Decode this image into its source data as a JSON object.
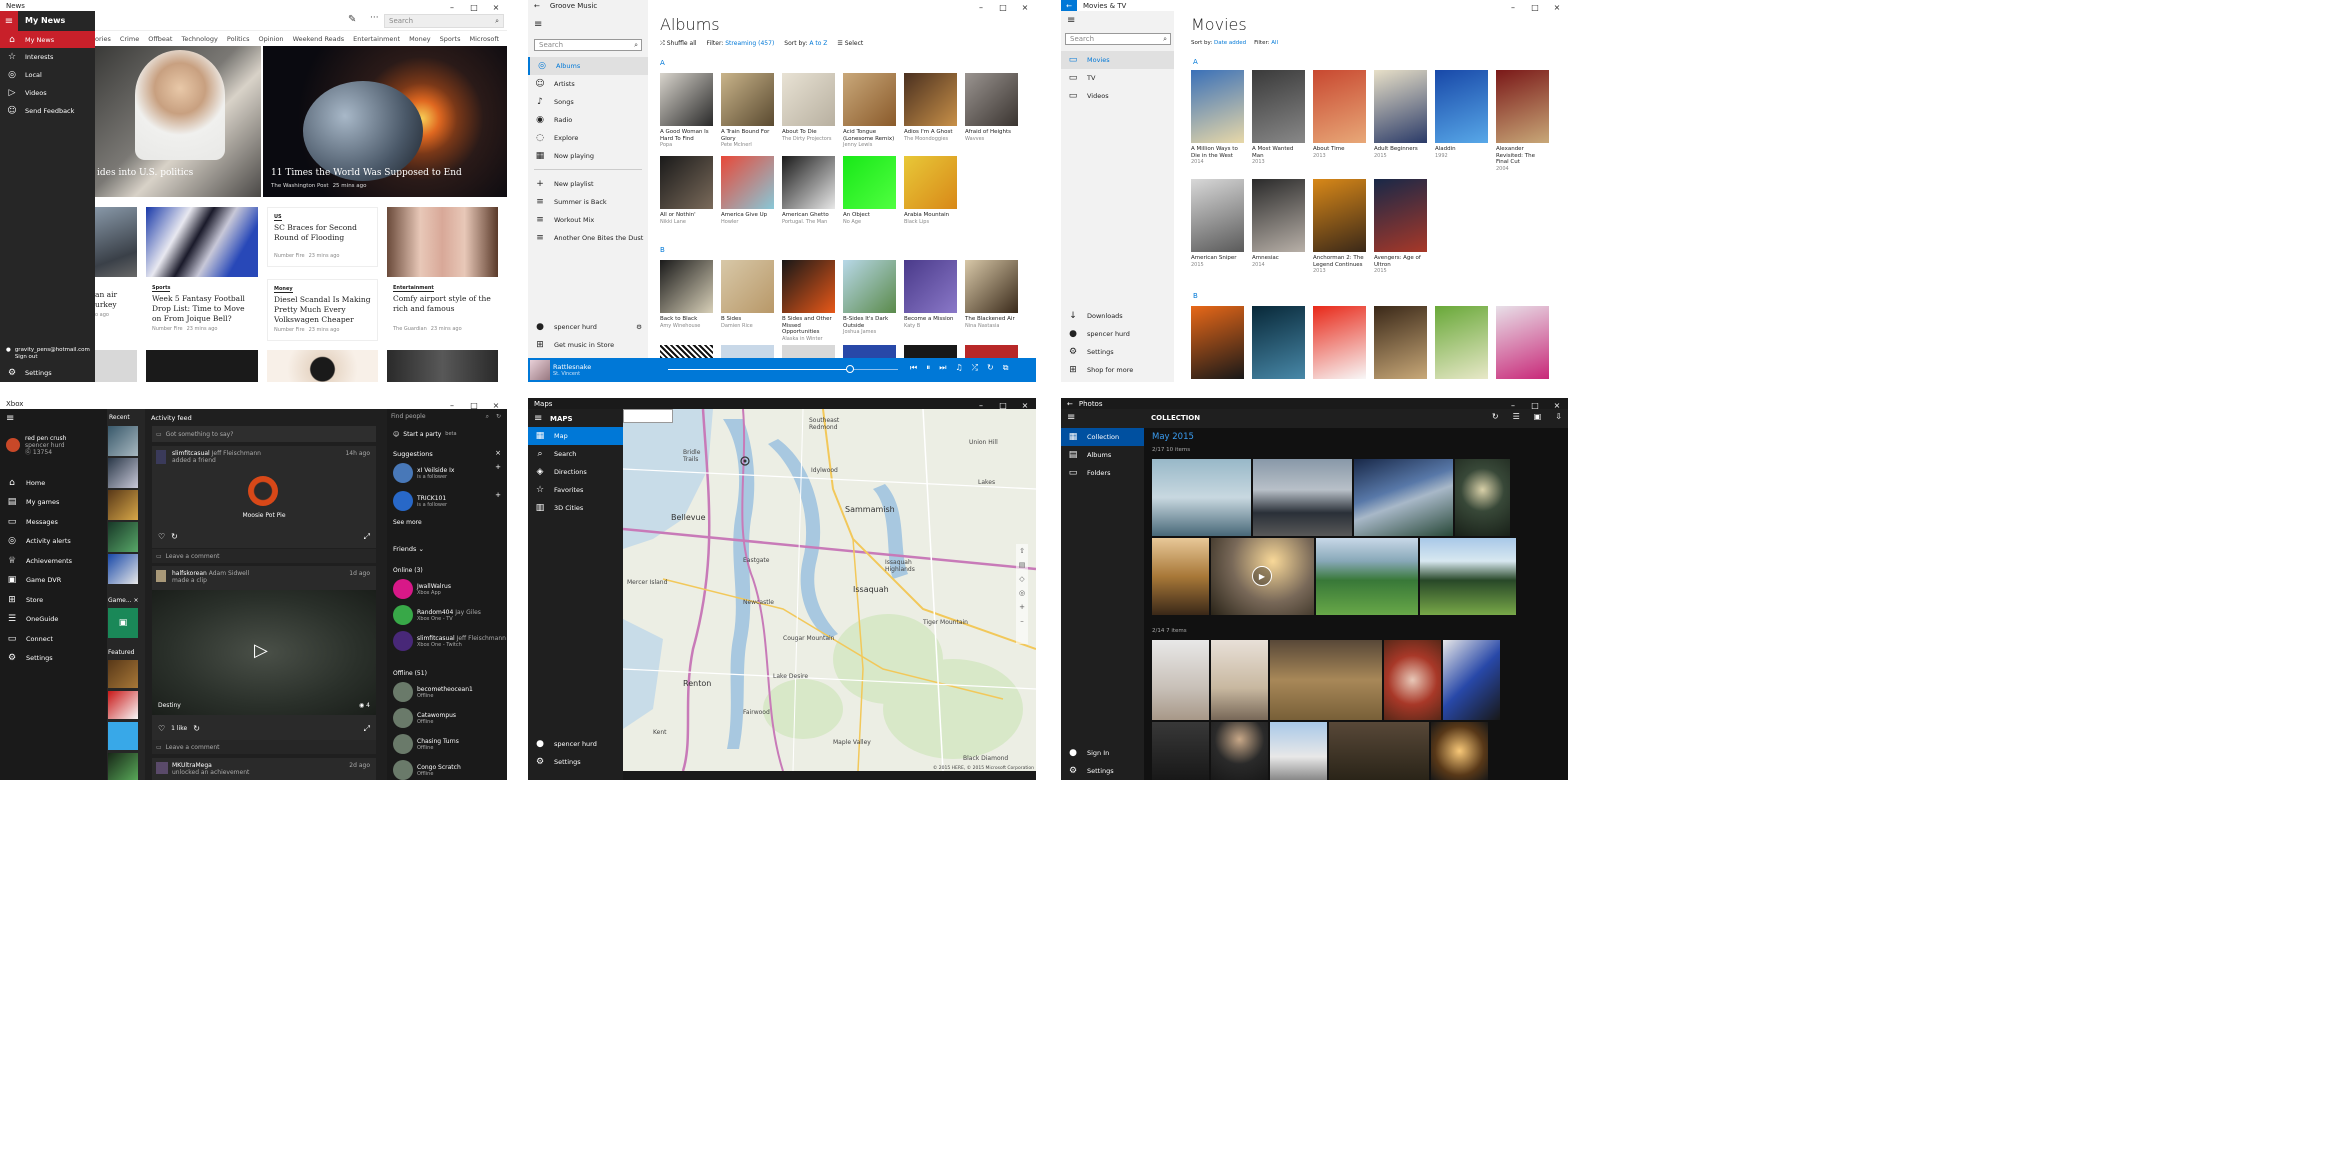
{
  "news": {
    "title": "News",
    "brand": "My News",
    "search_placeholder": "Search",
    "categories": [
      "ories",
      "Crime",
      "Offbeat",
      "Technology",
      "Politics",
      "Opinion",
      "Weekend Reads",
      "Entertainment",
      "Money",
      "Sports",
      "Microsoft"
    ],
    "nav": [
      {
        "label": "My News",
        "icon": "home-icon"
      },
      {
        "label": "Interests",
        "icon": "star-icon"
      },
      {
        "label": "Local",
        "icon": "pin-icon"
      },
      {
        "label": "Videos",
        "icon": "play-icon"
      },
      {
        "label": "Send Feedback",
        "icon": "feedback-icon"
      }
    ],
    "account": {
      "email": "gravity_pens@hotmail.com",
      "signout": "Sign out",
      "settings": "Settings"
    },
    "hero1": {
      "headline": "ides into U.S. politics"
    },
    "hero2": {
      "headline": "11 Times the World Was Supposed to End",
      "source": "The Washington Post",
      "time": "25 mins ago"
    },
    "cards": [
      {
        "tag": "",
        "headline": "an air\nurkey",
        "source": "",
        "time": "o ago"
      },
      {
        "tag": "Sports",
        "headline": "Week 5 Fantasy Football Drop List: Time to Move on From Joique Bell?",
        "source": "Number Fire",
        "time": "23 mins ago"
      },
      {
        "tag": "US",
        "headline": "SC Braces for Second Round of Flooding",
        "source": "Number Fire",
        "time": "23 mins ago"
      },
      {
        "tag": "Money",
        "headline": "Diesel Scandal Is Making Pretty Much Every Volkswagen Cheaper",
        "source": "Number Fire",
        "time": "23 mins ago"
      },
      {
        "tag": "Entertainment",
        "headline": "Comfy airport style of the rich and famous",
        "source": "The Guardian",
        "time": "23 mins ago"
      }
    ]
  },
  "groove": {
    "title": "Groove Music",
    "heading": "Albums",
    "search_placeholder": "Search",
    "toolbar": {
      "shuffle": "Shuffle all",
      "filter_label": "Filter:",
      "filter_value": "Streaming (457)",
      "sort_label": "Sort by:",
      "sort_value": "A to Z",
      "select": "Select"
    },
    "nav": [
      {
        "label": "Albums",
        "icon": "album-icon"
      },
      {
        "label": "Artists",
        "icon": "artist-icon"
      },
      {
        "label": "Songs",
        "icon": "note-icon"
      },
      {
        "label": "Radio",
        "icon": "radio-icon"
      },
      {
        "label": "Explore",
        "icon": "explore-icon"
      },
      {
        "label": "Now playing",
        "icon": "nowplaying-icon"
      }
    ],
    "playlists": [
      "New playlist",
      "Summer is Back",
      "Workout Mix",
      "Another One Bites the Dust"
    ],
    "user": "spencer hurd",
    "store": "Get music in Store",
    "now_playing": {
      "track": "Rattlesnake",
      "artist": "St. Vincent"
    },
    "section_a": "A",
    "section_b": "B",
    "albums_a1": [
      {
        "t": "A Good Woman Is Hard To Find",
        "a": "Popa",
        "c1": "#d8d4cc",
        "c2": "#2a2a2a"
      },
      {
        "t": "A Train Bound For Glory",
        "a": "Pete McInerl",
        "c1": "#c9b48a",
        "c2": "#5a4a30"
      },
      {
        "t": "About To Die",
        "a": "The Dirty Projectors",
        "c1": "#e8e2d4",
        "c2": "#b8b0a0"
      },
      {
        "t": "Acid Tongue (Lonesome Remix)",
        "a": "Jenny Lewis",
        "c1": "#c9a87a",
        "c2": "#8a5a2a"
      },
      {
        "t": "Adios I'm A Ghost",
        "a": "The Moondoggies",
        "c1": "#4a3020",
        "c2": "#c89048"
      },
      {
        "t": "Afraid of Heights",
        "a": "Wavves",
        "c1": "#9a9490",
        "c2": "#3a3430"
      }
    ],
    "albums_a2": [
      {
        "t": "All or Nothin'",
        "a": "Nikki Lane",
        "c1": "#1a1a1a",
        "c2": "#7a6a5a"
      },
      {
        "t": "America Give Up",
        "a": "Howler",
        "c1": "#e84838",
        "c2": "#88c8d8"
      },
      {
        "t": "American Ghetto",
        "a": "Portugal. The Man",
        "c1": "#1a1a1a",
        "c2": "#e8e8e8"
      },
      {
        "t": "An Object",
        "a": "No Age",
        "c1": "#18e818",
        "c2": "#50ff40"
      },
      {
        "t": "Arabia Mountain",
        "a": "Black Lips",
        "c1": "#e8c838",
        "c2": "#d88818"
      }
    ],
    "albums_b": [
      {
        "t": "Back to Black",
        "a": "Amy Winehouse",
        "c1": "#1a1a1a",
        "c2": "#d8d0b8"
      },
      {
        "t": "B Sides",
        "a": "Damien Rice",
        "c1": "#d8c8a8",
        "c2": "#b89868"
      },
      {
        "t": "B Sides and Other Missed Opportunities",
        "a": "Alaska in Winter",
        "c1": "#181818",
        "c2": "#e85818"
      },
      {
        "t": "B-Sides It's Dark Outside",
        "a": "Joshua James",
        "c1": "#b8d8e8",
        "c2": "#5a8a4a"
      },
      {
        "t": "Become a Mission",
        "a": "Katy B",
        "c1": "#4a3a8a",
        "c2": "#8a78c8"
      },
      {
        "t": "The Blackened Air",
        "a": "Nina Nastasia",
        "c1": "#d8c8a8",
        "c2": "#3a2a1a"
      }
    ]
  },
  "movies": {
    "title": "Movies & TV",
    "heading": "Movies",
    "search_placeholder": "Search",
    "sort_label": "Sort by:",
    "sort_value": "Date added",
    "filter_label": "Filter:",
    "filter_value": "All",
    "nav": [
      {
        "label": "Movies",
        "icon": "movie-icon"
      },
      {
        "label": "TV",
        "icon": "tv-icon"
      },
      {
        "label": "Videos",
        "icon": "video-icon"
      }
    ],
    "bottom": [
      {
        "label": "Downloads",
        "icon": "download-icon"
      },
      {
        "label": "spencer hurd",
        "icon": "avatar-icon"
      },
      {
        "label": "Settings",
        "icon": "gear-icon"
      },
      {
        "label": "Shop for more",
        "icon": "shop-icon"
      }
    ],
    "section_a": "A",
    "section_b": "B",
    "row1": [
      {
        "t": "A Million Ways to Die in the West",
        "y": "2014",
        "c1": "#3a70b8",
        "c2": "#e8d8a8"
      },
      {
        "t": "A Most Wanted Man",
        "y": "2013",
        "c1": "#3a3a3a",
        "c2": "#888"
      },
      {
        "t": "About Time",
        "y": "2013",
        "c1": "#c84830",
        "c2": "#e8a878"
      },
      {
        "t": "Adult Beginners",
        "y": "2015",
        "c1": "#e8e0c8",
        "c2": "#2a3a68"
      },
      {
        "t": "Aladdin",
        "y": "1992",
        "c1": "#1848a8",
        "c2": "#58a8e8"
      },
      {
        "t": "Alexander Revisited: The Final Cut",
        "y": "2004",
        "c1": "#7a1818",
        "c2": "#c8a878"
      }
    ],
    "row2": [
      {
        "t": "American Sniper",
        "y": "2015",
        "c1": "#d8d8d8",
        "c2": "#5a5a5a"
      },
      {
        "t": "Amnesiac",
        "y": "2014",
        "c1": "#2a2a2a",
        "c2": "#b8b0a8"
      },
      {
        "t": "Anchorman 2: The Legend Continues",
        "y": "2013",
        "c1": "#d88818",
        "c2": "#3a2818"
      },
      {
        "t": "Avengers: Age of Ultron",
        "y": "2015",
        "c1": "#182848",
        "c2": "#a83828"
      }
    ],
    "row3": [
      {
        "c1": "#e86818",
        "c2": "#181818"
      },
      {
        "c1": "#082838",
        "c2": "#4888a8"
      },
      {
        "c1": "#e82818",
        "c2": "#f8f8f8"
      },
      {
        "c1": "#3a2818",
        "c2": "#c8a878"
      },
      {
        "c1": "#68a838",
        "c2": "#e8e8c8"
      },
      {
        "c1": "#e8e0e8",
        "c2": "#c82878"
      }
    ]
  },
  "xbox": {
    "title": "Xbox",
    "user": {
      "name": "red pen crush",
      "real": "spencer hurd",
      "score": "13754"
    },
    "nav": [
      {
        "label": "Home",
        "icon": "home-icon"
      },
      {
        "label": "My games",
        "icon": "games-icon"
      },
      {
        "label": "Messages",
        "icon": "message-icon"
      },
      {
        "label": "Activity alerts",
        "icon": "globe-icon"
      },
      {
        "label": "Achievements",
        "icon": "trophy-icon"
      },
      {
        "label": "Game DVR",
        "icon": "dvr-icon"
      },
      {
        "label": "Store",
        "icon": "store-icon"
      },
      {
        "label": "OneGuide",
        "icon": "guide-icon"
      },
      {
        "label": "Connect",
        "icon": "connect-icon"
      },
      {
        "label": "Settings",
        "icon": "gear-icon"
      }
    ],
    "recent": "Recent",
    "game_hub": "Game...",
    "featured": "Featured",
    "feed_title": "Activity feed",
    "post_placeholder": "Got something to say?",
    "post1": {
      "user": "slimfitcasual",
      "real": "Jeff Fleischmann",
      "action": "added a friend",
      "time": "14h ago",
      "friend": "Moosie Pot Pie"
    },
    "comment": "Leave a comment",
    "post2": {
      "user": "halfskorean",
      "real": "Adam Sidwell",
      "action": "made a clip",
      "time": "1d ago",
      "game": "Destiny",
      "views": "4",
      "likes": "1 like"
    },
    "post3": {
      "user": "MKUltraMega",
      "action": "unlocked an achievement",
      "time": "2d ago"
    },
    "find": "Find people",
    "party": "Start a party",
    "beta": "beta",
    "suggestions": "Suggestions",
    "sugg": [
      {
        "name": "xI Veilside Ix",
        "sub": "is a follower"
      },
      {
        "name": "TRICK101",
        "sub": "is a follower"
      }
    ],
    "see_more": "See more",
    "friends": "Friends",
    "online": "Online (3)",
    "online_list": [
      {
        "name": "JwallWalrus",
        "sub": "Xbox App",
        "c": "#d81888"
      },
      {
        "name": "Random404",
        "real": "Jay Giles",
        "sub": "Xbox One - TV",
        "c": "#38a848"
      },
      {
        "name": "slimfitcasual",
        "real": "Jeff Fleischmann",
        "sub": "Xbox One - Twitch",
        "c": "#482878"
      }
    ],
    "offline": "Offline (51)",
    "offline_list": [
      {
        "name": "becometheocean1",
        "sub": "Offline"
      },
      {
        "name": "Catawompus",
        "sub": "Offline"
      },
      {
        "name": "Chasing Turns",
        "sub": "Offline"
      },
      {
        "name": "Congo Scratch",
        "sub": "Offline"
      }
    ]
  },
  "maps": {
    "title": "Maps",
    "heading": "MAPS",
    "nav": [
      {
        "label": "Map",
        "icon": "map-icon"
      },
      {
        "label": "Search",
        "icon": "search-icon"
      },
      {
        "label": "Directions",
        "icon": "directions-icon"
      },
      {
        "label": "Favorites",
        "icon": "star-icon"
      },
      {
        "label": "3D Cities",
        "icon": "city-icon"
      }
    ],
    "user": "spencer hurd",
    "settings": "Settings",
    "places": [
      "Southeast Redmond",
      "Bridle Trails",
      "Idylwood",
      "Bellevue",
      "Sammamish",
      "Eastgate",
      "Issaquah",
      "Mercer Island",
      "Newcastle",
      "Renton",
      "Fairwood",
      "Maple Valley",
      "Lake Desire",
      "Cougar Mountain",
      "Tiger Mountain",
      "Issaquah Highlands",
      "Lakes",
      "Kent",
      "Union Hill",
      "Black Diamond"
    ],
    "copyright": "© 2015 HERE, © 2015 Microsoft Corporation"
  },
  "photos": {
    "title": "Photos",
    "heading": "COLLECTION",
    "nav": [
      {
        "label": "Collection",
        "icon": "collection-icon"
      },
      {
        "label": "Albums",
        "icon": "albums-icon"
      },
      {
        "label": "Folders",
        "icon": "folder-icon"
      }
    ],
    "bottom": [
      {
        "label": "Sign In",
        "icon": "avatar-icon"
      },
      {
        "label": "Settings",
        "icon": "gear-icon"
      }
    ],
    "month": "May 2015",
    "group1": "2/17",
    "group1_count": "10 items",
    "group2": "2/14",
    "group2_count": "7 items"
  }
}
